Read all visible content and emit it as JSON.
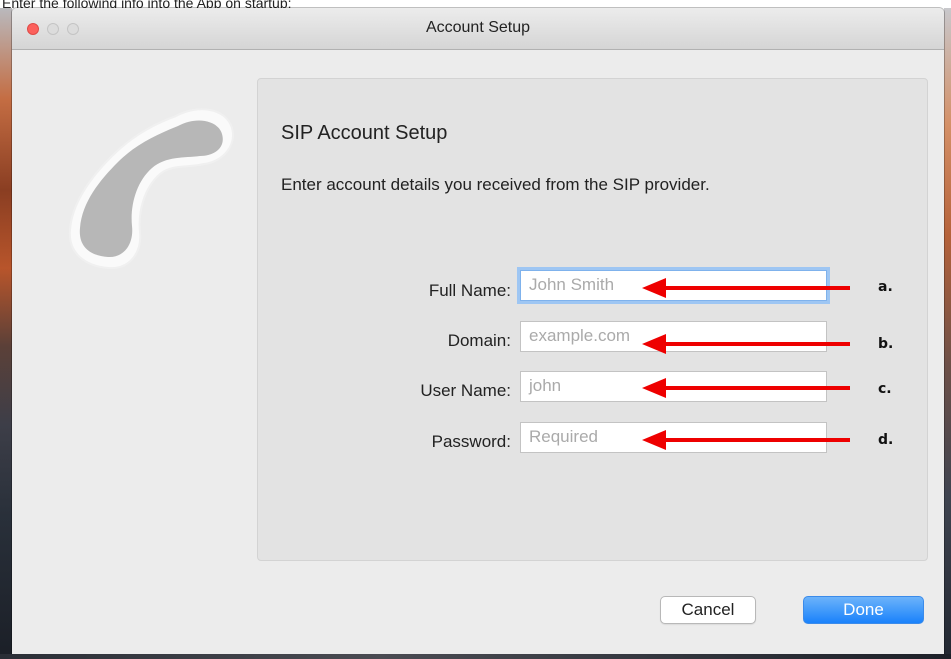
{
  "caption": "Enter the following info into the App on startup:",
  "window": {
    "title": "Account Setup"
  },
  "app_icon": "phone-icon",
  "form": {
    "heading": "SIP Account Setup",
    "subtitle": "Enter account details you received from the SIP provider.",
    "fields": [
      {
        "label": "Full Name:",
        "placeholder": "John Smith",
        "marker": "a."
      },
      {
        "label": "Domain:",
        "placeholder": "example.com",
        "marker": "b."
      },
      {
        "label": "User Name:",
        "placeholder": "john",
        "marker": "c."
      },
      {
        "label": "Password:",
        "placeholder": "Required",
        "marker": "d."
      }
    ]
  },
  "buttons": {
    "cancel": "Cancel",
    "done": "Done"
  },
  "colors": {
    "accent": "#1a82fb",
    "annotation_arrow": "#ee0000",
    "close_button": "#fc605c"
  }
}
